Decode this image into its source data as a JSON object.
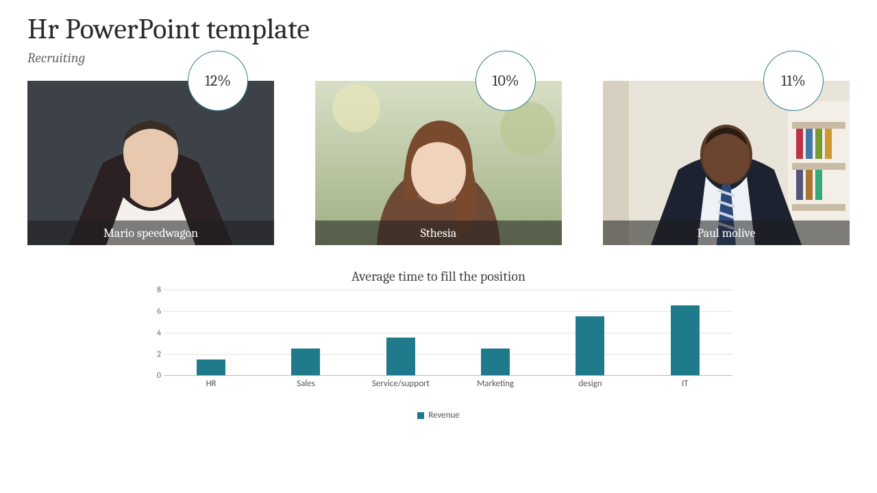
{
  "title": "Hr PowerPoint template",
  "subtitle": "Recruiting",
  "accent_color": "#1f7a8c",
  "cards": [
    {
      "name": "Mario speedwagon",
      "badge": "12%"
    },
    {
      "name": "Sthesia",
      "badge": "10%"
    },
    {
      "name": "Paul molive",
      "badge": "11%"
    }
  ],
  "chart_data": {
    "type": "bar",
    "title": "Average time to fill the position",
    "xlabel": "",
    "ylabel": "",
    "ylim": [
      0,
      8
    ],
    "yticks": [
      0,
      2,
      4,
      6,
      8
    ],
    "categories": [
      "HR",
      "Sales",
      "Service/support",
      "Marketing",
      "design",
      "IT"
    ],
    "series": [
      {
        "name": "Revenue",
        "values": [
          1.5,
          2.5,
          3.5,
          2.5,
          5.5,
          6.5
        ]
      }
    ]
  }
}
